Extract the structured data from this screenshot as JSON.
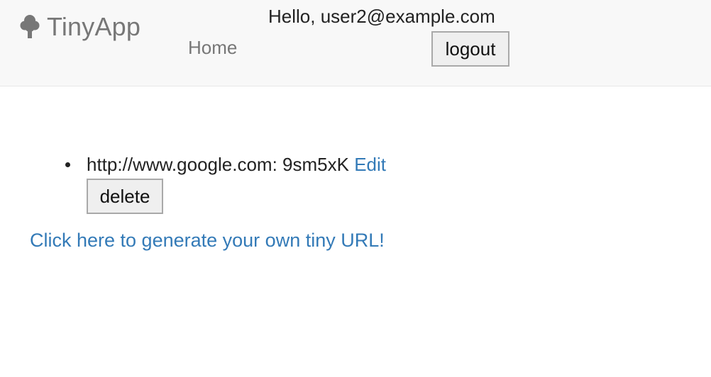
{
  "navbar": {
    "brand": {
      "icon": "tree-icon",
      "text": "TinyApp"
    },
    "home_label": "Home",
    "greeting": "Hello, user2@example.com",
    "logout_label": "logout"
  },
  "urls": [
    {
      "long_url": "http://www.google.com:",
      "short_id": "9sm5xK",
      "edit_label": "Edit",
      "delete_label": "delete"
    }
  ],
  "generate_link_text": "Click here to generate your own tiny URL!",
  "colors": {
    "navbar_bg": "#f8f8f8",
    "link": "#337ab7",
    "muted_text": "#777777"
  }
}
